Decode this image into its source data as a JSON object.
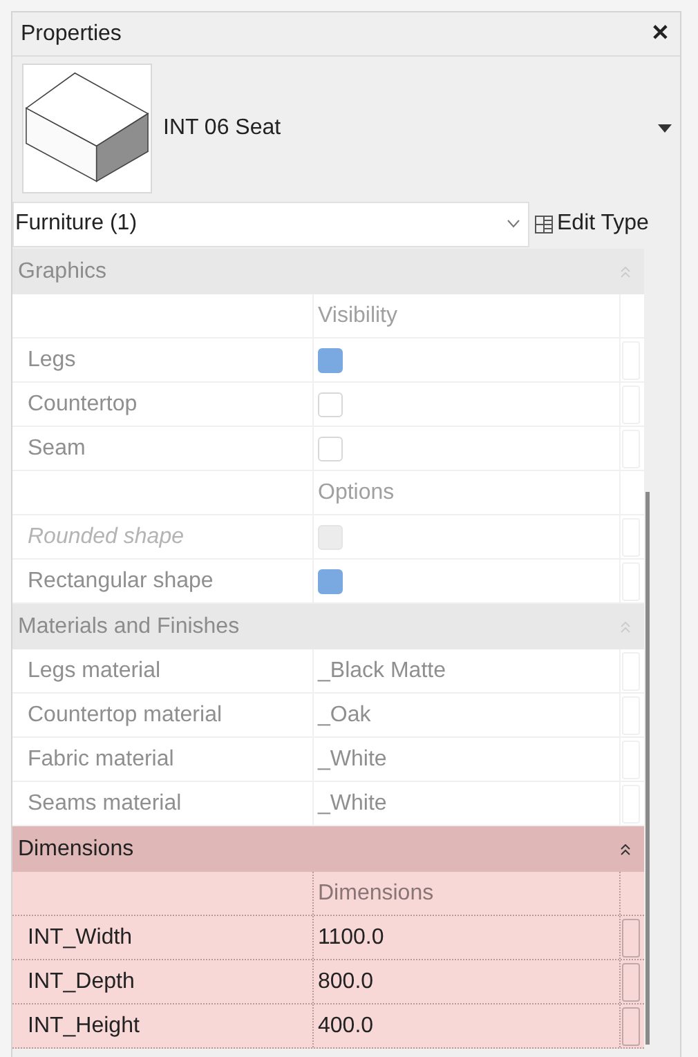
{
  "window": {
    "title": "Properties",
    "close": "✕"
  },
  "type_selector": {
    "name": "INT 06 Seat"
  },
  "filter": {
    "value": "Furniture (1)",
    "edit_type": "Edit Type"
  },
  "groups": [
    {
      "title": "Graphics",
      "faded": true,
      "highlighted": false,
      "rows": [
        {
          "kind": "subheader",
          "text": "Visibility"
        },
        {
          "kind": "checkbox",
          "label": "Legs",
          "checked": true,
          "disabled": false
        },
        {
          "kind": "checkbox",
          "label": "Countertop",
          "checked": false,
          "disabled": false
        },
        {
          "kind": "checkbox",
          "label": "Seam",
          "checked": false,
          "disabled": false
        },
        {
          "kind": "subheader",
          "text": "Options"
        },
        {
          "kind": "checkbox",
          "label": "Rounded shape",
          "checked": false,
          "disabled": true
        },
        {
          "kind": "checkbox",
          "label": "Rectangular shape",
          "checked": true,
          "disabled": false
        }
      ]
    },
    {
      "title": "Materials and Finishes",
      "faded": true,
      "highlighted": false,
      "rows": [
        {
          "kind": "value",
          "label": "Legs material",
          "value": "_Black Matte"
        },
        {
          "kind": "value",
          "label": "Countertop material",
          "value": "_Oak"
        },
        {
          "kind": "value",
          "label": "Fabric material",
          "value": "_White"
        },
        {
          "kind": "value",
          "label": "Seams material",
          "value": "_White"
        }
      ]
    },
    {
      "title": "Dimensions",
      "faded": false,
      "highlighted": true,
      "rows": [
        {
          "kind": "subheader",
          "text": "Dimensions"
        },
        {
          "kind": "value",
          "label": "INT_Width",
          "value": "1100.0"
        },
        {
          "kind": "value",
          "label": "INT_Depth",
          "value": "800.0"
        },
        {
          "kind": "value",
          "label": "INT_Height",
          "value": "400.0"
        }
      ]
    }
  ]
}
